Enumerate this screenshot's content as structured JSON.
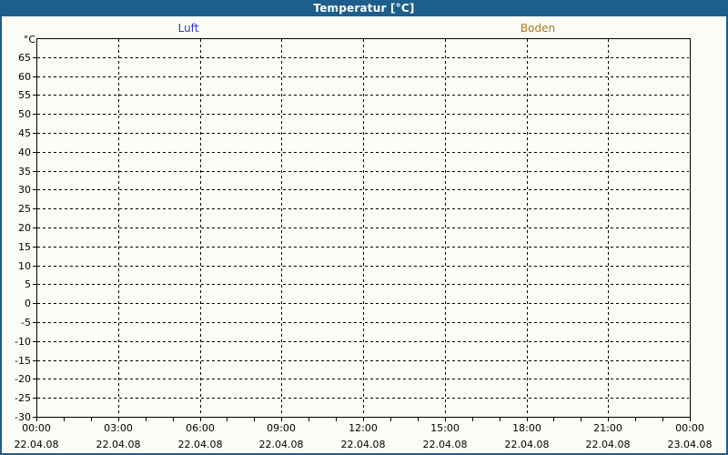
{
  "window": {
    "title": "Temperatur [°C]",
    "title_bar_color": "#1d5e8d",
    "border_color": "#1d5e8d",
    "background_color": "#fcfcf6"
  },
  "legend": {
    "position": "top",
    "items": [
      {
        "label": "Luft",
        "color": "#3333cc"
      },
      {
        "label": "Boden",
        "color": "#aa7820"
      }
    ]
  },
  "chart_data": {
    "type": "line",
    "title": "Temperatur [°C]",
    "grid": {
      "style": "dashed",
      "color": "#000000",
      "grid_on": true
    },
    "y_axis": {
      "unit_label": "°C",
      "min": -30,
      "max": 70,
      "tick_step": 5,
      "tick_labels": [
        65,
        60,
        55,
        50,
        45,
        40,
        35,
        30,
        25,
        20,
        15,
        10,
        5,
        0,
        -5,
        -10,
        -15,
        -20,
        -25,
        -30
      ]
    },
    "x_axis": {
      "range_hours": [
        0,
        24
      ],
      "major_step_hours": 3,
      "minor_step_hours": 1,
      "ticks": [
        {
          "hour": 0,
          "time": "00:00",
          "date": "22.04.08"
        },
        {
          "hour": 3,
          "time": "03:00",
          "date": "22.04.08"
        },
        {
          "hour": 6,
          "time": "06:00",
          "date": "22.04.08"
        },
        {
          "hour": 9,
          "time": "09:00",
          "date": "22.04.08"
        },
        {
          "hour": 12,
          "time": "12:00",
          "date": "22.04.08"
        },
        {
          "hour": 15,
          "time": "15:00",
          "date": "22.04.08"
        },
        {
          "hour": 18,
          "time": "18:00",
          "date": "22.04.08"
        },
        {
          "hour": 21,
          "time": "21:00",
          "date": "22.04.08"
        },
        {
          "hour": 24,
          "time": "00:00",
          "date": "23.04.08"
        }
      ]
    },
    "series": [
      {
        "name": "Luft",
        "color": "#3333cc",
        "points": []
      },
      {
        "name": "Boden",
        "color": "#aa7820",
        "points": []
      }
    ]
  }
}
